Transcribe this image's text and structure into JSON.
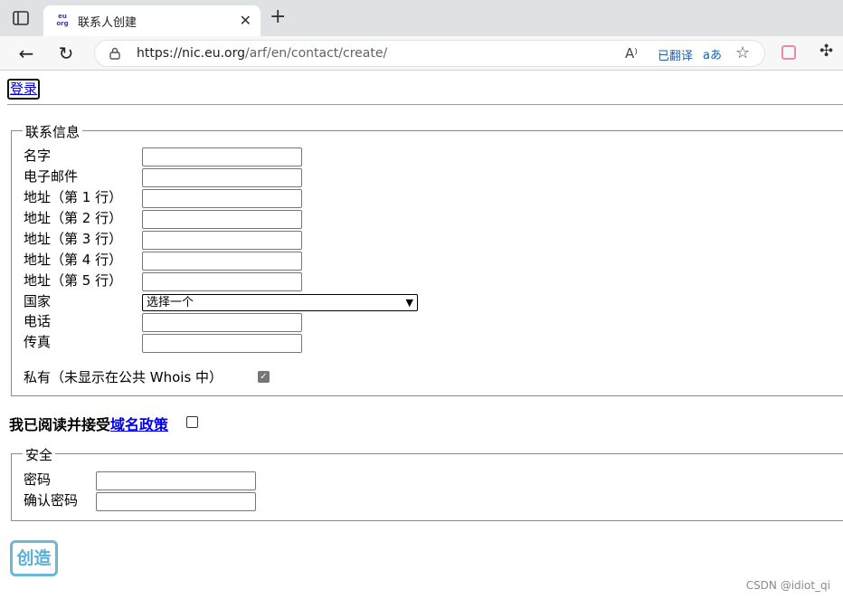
{
  "tab": {
    "favicon_text": "eu org",
    "title": "联系人创建"
  },
  "toolbar": {
    "url_host": "https://nic.eu.org",
    "url_path": "/arf/en/contact/create/",
    "translated_label": "已翻译",
    "aa_label": "aあ"
  },
  "page": {
    "login_link": "登录",
    "contact": {
      "legend": "联系信息",
      "name_label": "名字",
      "email_label": "电子邮件",
      "addr1_label": "地址（第 1 行）",
      "addr2_label": "地址（第 2 行）",
      "addr3_label": "地址（第 3 行）",
      "addr4_label": "地址（第 4 行）",
      "addr5_label": "地址（第 5 行）",
      "country_label": "国家",
      "country_selected": "选择一个",
      "phone_label": "电话",
      "fax_label": "传真",
      "private_label": "私有（未显示在公共 Whois 中）",
      "private_checked": true
    },
    "agree": {
      "prefix": "我已阅读并接受",
      "link": "域名政策",
      "checked": false
    },
    "security": {
      "legend": "安全",
      "password_label": "密码",
      "confirm_label": "确认密码"
    },
    "create_button": "创造",
    "watermark": "CSDN @idiot_qi"
  }
}
